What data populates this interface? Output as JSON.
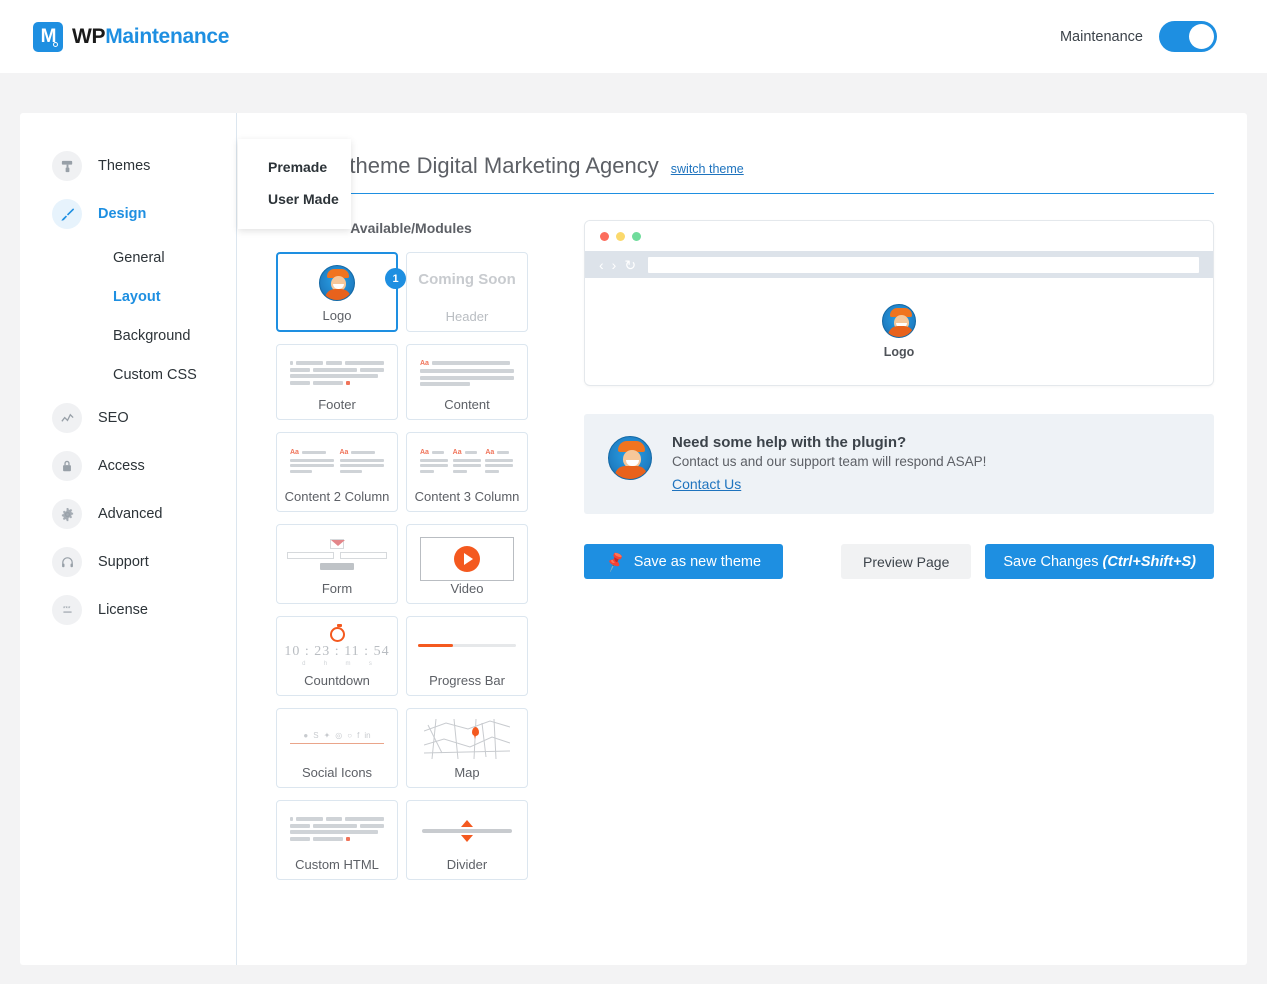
{
  "header": {
    "brand_mark": "M",
    "brand_wp": "WP",
    "brand_maintenance": "Maintenance",
    "maintenance_label": "Maintenance",
    "toggle_state": "on",
    "accent": "#1e8fe1"
  },
  "sidebar": {
    "items": [
      {
        "label": "Themes",
        "icon": "paint-roller-icon",
        "active": false
      },
      {
        "label": "Design",
        "icon": "brush-icon",
        "active": true
      },
      {
        "label": "SEO",
        "icon": "chart-line-icon",
        "active": false
      },
      {
        "label": "Access",
        "icon": "lock-icon",
        "active": false
      },
      {
        "label": "Advanced",
        "icon": "gear-icon",
        "active": false
      },
      {
        "label": "Support",
        "icon": "headset-icon",
        "active": false
      },
      {
        "label": "License",
        "icon": "key-icon",
        "active": false
      }
    ],
    "sub_items": [
      {
        "label": "General",
        "active": false
      },
      {
        "label": "Layout",
        "active": true
      },
      {
        "label": "Background",
        "active": false
      },
      {
        "label": "Custom CSS",
        "active": false
      }
    ]
  },
  "dropdown": {
    "items": [
      "Premade",
      "User Made"
    ]
  },
  "page": {
    "title": "Editing theme Digital Marketing Agency",
    "switch_theme": "switch theme"
  },
  "modules": {
    "column_title": "Available/Modules",
    "items": [
      {
        "name": "Logo",
        "thumb": "avatar",
        "selected": true,
        "badge": "1"
      },
      {
        "name": "Header",
        "thumb": "coming-soon",
        "coming_soon_text": "Coming Soon",
        "muted": true
      },
      {
        "name": "Footer",
        "thumb": "lines-footer"
      },
      {
        "name": "Content",
        "thumb": "lines-content"
      },
      {
        "name": "Content 2 Column",
        "thumb": "lines-2col"
      },
      {
        "name": "Content 3 Column",
        "thumb": "lines-3col"
      },
      {
        "name": "Form",
        "thumb": "form"
      },
      {
        "name": "Video",
        "thumb": "video"
      },
      {
        "name": "Countdown",
        "thumb": "countdown",
        "countdown_value": "10 : 23 : 11 : 54",
        "countdown_units": [
          "d",
          "h",
          "m",
          "s"
        ]
      },
      {
        "name": "Progress Bar",
        "thumb": "progress"
      },
      {
        "name": "Social Icons",
        "thumb": "social"
      },
      {
        "name": "Map",
        "thumb": "map"
      },
      {
        "name": "Custom HTML",
        "thumb": "lines-footer"
      },
      {
        "name": "Divider",
        "thumb": "divider"
      }
    ]
  },
  "preview": {
    "url_value": "",
    "logo_label": "Logo",
    "traffic_lights": [
      "#fc6d5d",
      "#fbd96c",
      "#70dc9c"
    ],
    "nav_back": "‹",
    "nav_forward": "›",
    "nav_reload": "↻"
  },
  "help": {
    "title": "Need some help with the plugin?",
    "text": "Contact us and our support team will respond ASAP!",
    "link": "Contact Us"
  },
  "actions": {
    "save_as_new": "Save as new theme",
    "preview_page": "Preview Page",
    "save_changes": "Save Changes",
    "save_shortcut": "(Ctrl+Shift+S)"
  }
}
